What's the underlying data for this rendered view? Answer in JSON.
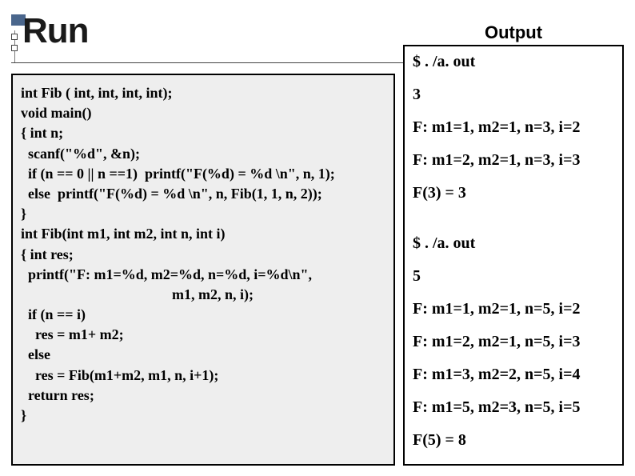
{
  "title": "Run",
  "output_header": "Output",
  "code": "int Fib ( int, int, int, int);\nvoid main()\n{ int n;\n  scanf(\"%d\", &n);\n  if (n == 0 || n ==1)  printf(\"F(%d) = %d \\n\", n, 1);\n  else  printf(\"F(%d) = %d \\n\", n, Fib(1, 1, n, 2));\n}\nint Fib(int m1, int m2, int n, int i)\n{ int res;\n  printf(\"F: m1=%d, m2=%d, n=%d, i=%d\\n\",\n                                          m1, m2, n, i);\n  if (n == i)\n    res = m1+ m2;\n  else\n    res = Fib(m1+m2, m1, n, i+1);\n  return res;\n}",
  "output": {
    "run1": {
      "cmd": "$ . /a. out",
      "input": "3",
      "lines": [
        "F: m1=1, m2=1, n=3, i=2",
        "F: m1=2, m2=1, n=3, i=3",
        "F(3) = 3"
      ]
    },
    "run2": {
      "cmd": "$ . /a. out",
      "input": "5",
      "lines": [
        "F: m1=1, m2=1, n=5, i=2",
        "F: m1=2, m2=1, n=5, i=3",
        "F: m1=3, m2=2, n=5, i=4",
        "F: m1=5, m2=3, n=5, i=5",
        "F(5) = 8"
      ]
    }
  }
}
